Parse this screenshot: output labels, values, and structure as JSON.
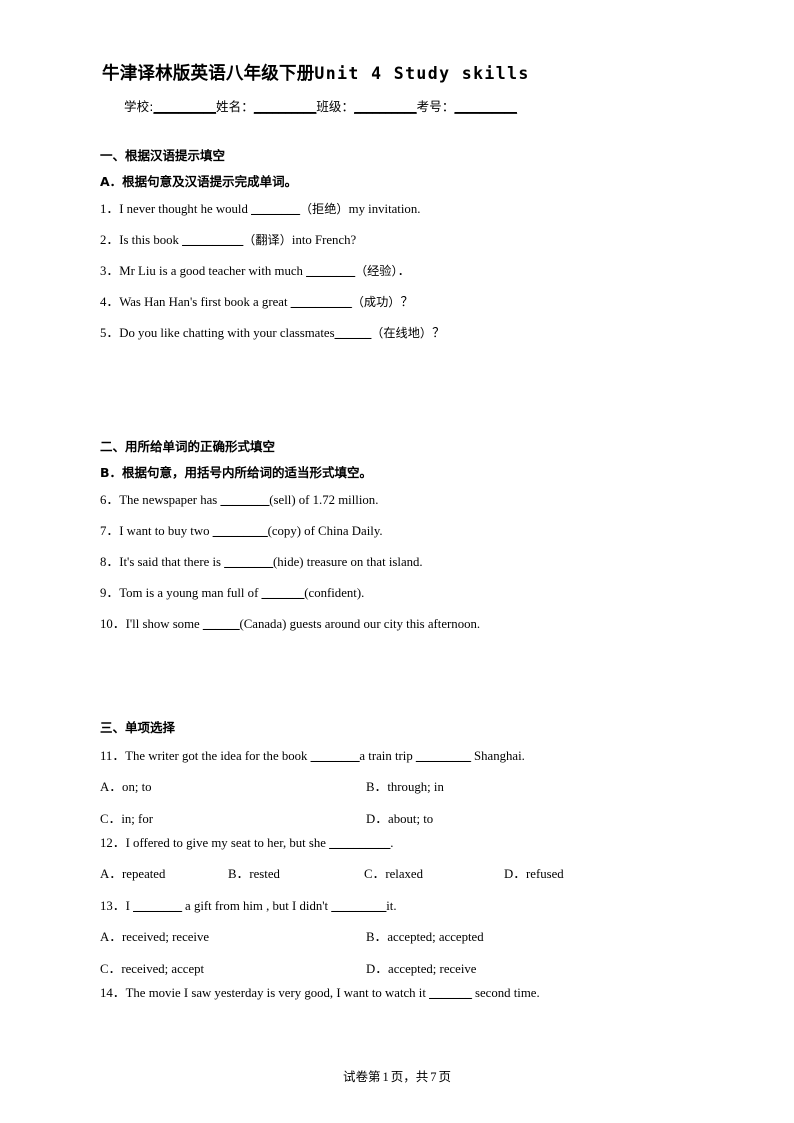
{
  "document": {
    "title_cn": "牛津译林版英语八年级下册",
    "title_en": "Unit 4 Study skills",
    "info_line": {
      "school_label": "学校:",
      "school_blank": "__________",
      "name_label": "姓名：",
      "name_blank": "__________",
      "class_label": "班级：",
      "class_blank": "__________",
      "exam_no_label": "考号：",
      "exam_no_blank": "__________"
    },
    "footer": {
      "prefix": "试卷第",
      "current_page": "1",
      "middle": "页，共",
      "total_pages": "7",
      "suffix": "页"
    }
  },
  "sections": [
    {
      "heading": "一、根据汉语提示填空",
      "subheading": "A．根据句意及汉语提示完成单词。",
      "questions": [
        {
          "num": "1．",
          "pre": "I never thought he would ",
          "blank": "________",
          "hint": "（拒绝）",
          "post": "my invitation."
        },
        {
          "num": "2．",
          "pre": "Is this book ",
          "blank": "__________",
          "hint": "（翻译）",
          "post": "into French?"
        },
        {
          "num": "3．",
          "pre": "Mr Liu is a good teacher with much ",
          "blank": "________",
          "hint": "（经验）",
          "post": "．"
        },
        {
          "num": "4．",
          "pre": "Was Han Han's first book a great ",
          "blank": "__________",
          "hint": "（成功）",
          "post": "？"
        },
        {
          "num": "5．",
          "pre": "Do you like chatting with your classmates",
          "blank": "______",
          "hint": "（在线地）",
          "post": "？"
        }
      ]
    },
    {
      "heading": "二、用所给单词的正确形式填空",
      "subheading": "B．根据句意，用括号内所给词的适当形式填空。",
      "questions": [
        {
          "num": "6．",
          "pre": "The newspaper has ",
          "blank": "________",
          "hint": "(sell)",
          "post": " of 1.72 million."
        },
        {
          "num": "7．",
          "pre": "I want to buy two ",
          "blank": "_________",
          "hint": "(copy)",
          "post": " of China Daily."
        },
        {
          "num": "8．",
          "pre": "It's said that there is ",
          "blank": "________",
          "hint": "(hide)",
          "post": " treasure on that island."
        },
        {
          "num": "9．",
          "pre": "Tom is a young man full of ",
          "blank": "_______",
          "hint": "(confident)",
          "post": "."
        },
        {
          "num": "10．",
          "pre": "I'll show some ",
          "blank": "______",
          "hint": "(Canada)",
          "post": " guests around our city this afternoon."
        }
      ]
    }
  ],
  "choice_section": {
    "heading": "三、单项选择",
    "questions": [
      {
        "num": "11．",
        "text_1": "The writer got the idea for the book ",
        "blank_1": "________",
        "text_2": "a train trip ",
        "blank_2": "_________",
        "text_3": " Shanghai.",
        "layout": "two-column",
        "options": [
          {
            "key": "A．",
            "text": "on; to"
          },
          {
            "key": "B．",
            "text": "through; in"
          },
          {
            "key": "C．",
            "text": "in; for"
          },
          {
            "key": "D．",
            "text": "about; to"
          }
        ]
      },
      {
        "num": "12．",
        "text_1": "I offered to give my seat to her, but she ",
        "blank_1": "__________",
        "text_2": ".",
        "layout": "four-column",
        "options": [
          {
            "key": "A．",
            "text": "repeated"
          },
          {
            "key": "B．",
            "text": "rested"
          },
          {
            "key": "C．",
            "text": "relaxed"
          },
          {
            "key": "D．",
            "text": "refused"
          }
        ]
      },
      {
        "num": "13．",
        "text_1": "I ",
        "blank_1": "________",
        "text_2": " a gift from him , but I didn't ",
        "blank_2": "_________",
        "text_3": "it.",
        "layout": "two-column",
        "options": [
          {
            "key": "A．",
            "text": "received; receive"
          },
          {
            "key": "B．",
            "text": "accepted; accepted"
          },
          {
            "key": "C．",
            "text": "received; accept"
          },
          {
            "key": "D．",
            "text": "accepted; receive"
          }
        ]
      },
      {
        "num": "14．",
        "text_1": "The movie I saw yesterday is very good, I want to watch it ",
        "blank_1": "_______",
        "text_2": " second time.",
        "layout": "none",
        "options": []
      }
    ]
  }
}
